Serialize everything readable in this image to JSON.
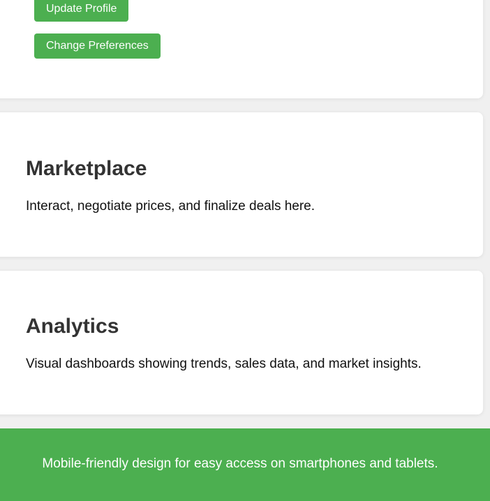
{
  "profile": {
    "update_button": "Update Profile",
    "preferences_button": "Change Preferences"
  },
  "marketplace": {
    "title": "Marketplace",
    "description": "Interact, negotiate prices, and finalize deals here."
  },
  "analytics": {
    "title": "Analytics",
    "description": "Visual dashboards showing trends, sales data, and market insights."
  },
  "footer": {
    "text": "Mobile-friendly design for easy access on smartphones and tablets."
  },
  "colors": {
    "accent": "#4caf50",
    "card_background": "#ffffff",
    "page_background": "#f0f0f0"
  }
}
